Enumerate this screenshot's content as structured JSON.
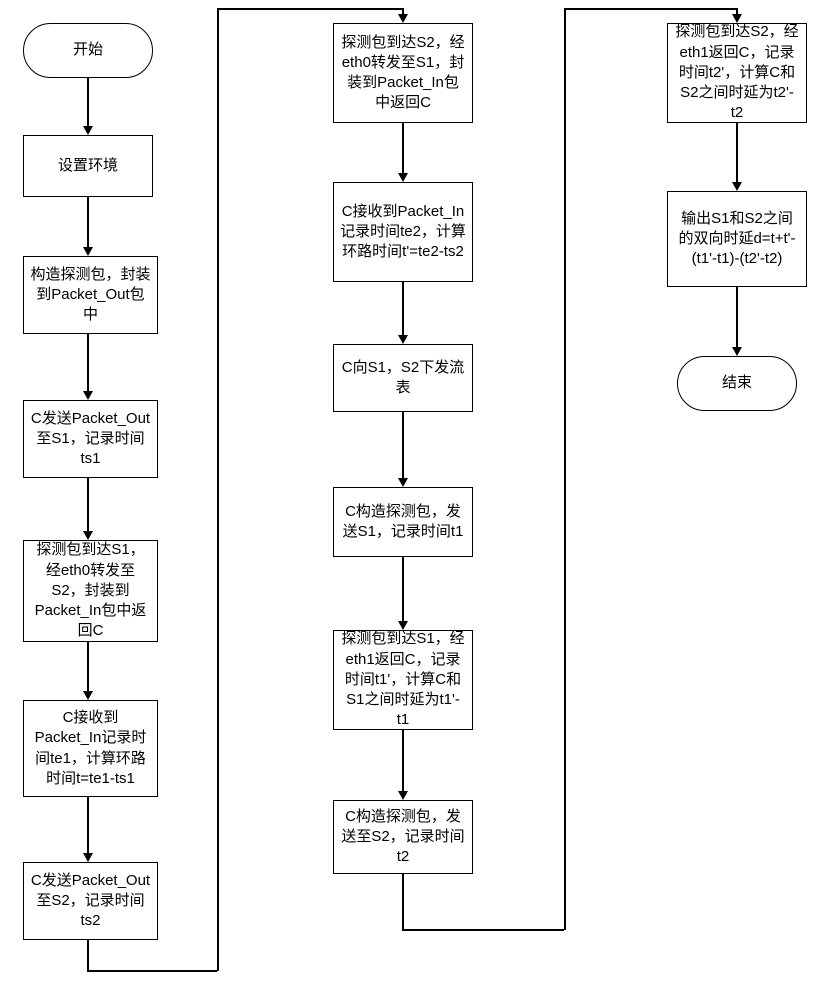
{
  "flow": {
    "start": "开始",
    "step1": "设置环境",
    "step2": "构造探测包，封装到Packet_Out包中",
    "step3": "C发送Packet_Out至S1，记录时间ts1",
    "step4": "探测包到达S1，经eth0转发至S2，封装到Packet_In包中返回C",
    "step5": "C接收到Packet_In记录时间te1，计算环路时间t=te1-ts1",
    "step6": "C发送Packet_Out至S2，记录时间ts2",
    "step7": "探测包到达S2，经eth0转发至S1，封装到Packet_In包中返回C",
    "step8": "C接收到Packet_In记录时间te2，计算环路时间t'=te2-ts2",
    "step9": "C向S1，S2下发流表",
    "step10": "C构造探测包，发送S1，记录时间t1",
    "step11": "探测包到达S1，经eth1返回C，记录时间t1'，计算C和S1之间时延为t1'-t1",
    "step12": "C构造探测包，发送至S2，记录时间t2",
    "step13": "探测包到达S2，经eth1返回C，记录时间t2'，计算C和S2之间时延为t2'-t2",
    "step14": "输出S1和S2之间的双向时延d=t+t'-(t1'-t1)-(t2'-t2)",
    "end": "结束"
  }
}
